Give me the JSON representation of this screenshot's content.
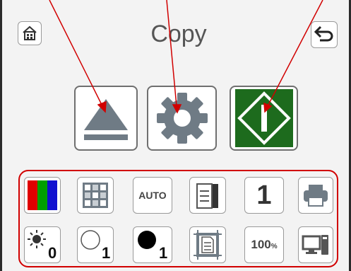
{
  "header": {
    "title": "Copy",
    "home_icon": "home-icon",
    "back_icon": "back-arrow-icon"
  },
  "actions": [
    {
      "name": "eject-button",
      "icon": "eject-icon"
    },
    {
      "name": "settings-button",
      "icon": "gear-icon"
    },
    {
      "name": "start-button",
      "icon": "start-icon"
    }
  ],
  "settings_row1": {
    "color_icon": "color-mode-icon",
    "layout_icon": "layout-grid-icon",
    "auto_label": "AUTO",
    "duplex_icon": "duplex-document-icon",
    "copies_label": "1",
    "printer_icon": "printer-icon"
  },
  "settings_row2": {
    "brightness_value": "0",
    "light_value": "1",
    "dark_value": "1",
    "border_icon": "border-erase-icon",
    "zoom_label": "100",
    "zoom_unit": "%",
    "screen_icon": "screen-layout-icon"
  },
  "colors": {
    "accent_red": "#d10000",
    "start_green": "#1d6b1d",
    "icon_gray": "#6f7b85"
  }
}
